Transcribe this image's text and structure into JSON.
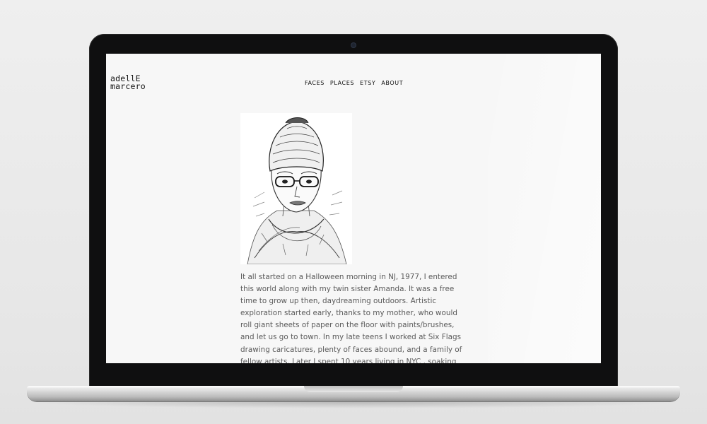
{
  "site": {
    "logo_line1": "adellE",
    "logo_line2": "marcero"
  },
  "nav": [
    {
      "label": "FACES"
    },
    {
      "label": "PLACES"
    },
    {
      "label": "ETSY"
    },
    {
      "label": "ABOUT"
    }
  ],
  "about": {
    "bio": "It all started on a Halloween morning in NJ, 1977, I entered this world along with my twin sister Amanda. It was a free time to grow up then, daydreaming outdoors. Artistic exploration started early, thanks to my mother, who would roll giant sheets of paper on the floor with paints/brushes, and let us go to town. In my late teens I worked at Six Flags drawing caricatures, plenty of faces abound, and a family of fellow artists. Later I spent 10 years living in NYC , soaking the up city life, and"
  }
}
